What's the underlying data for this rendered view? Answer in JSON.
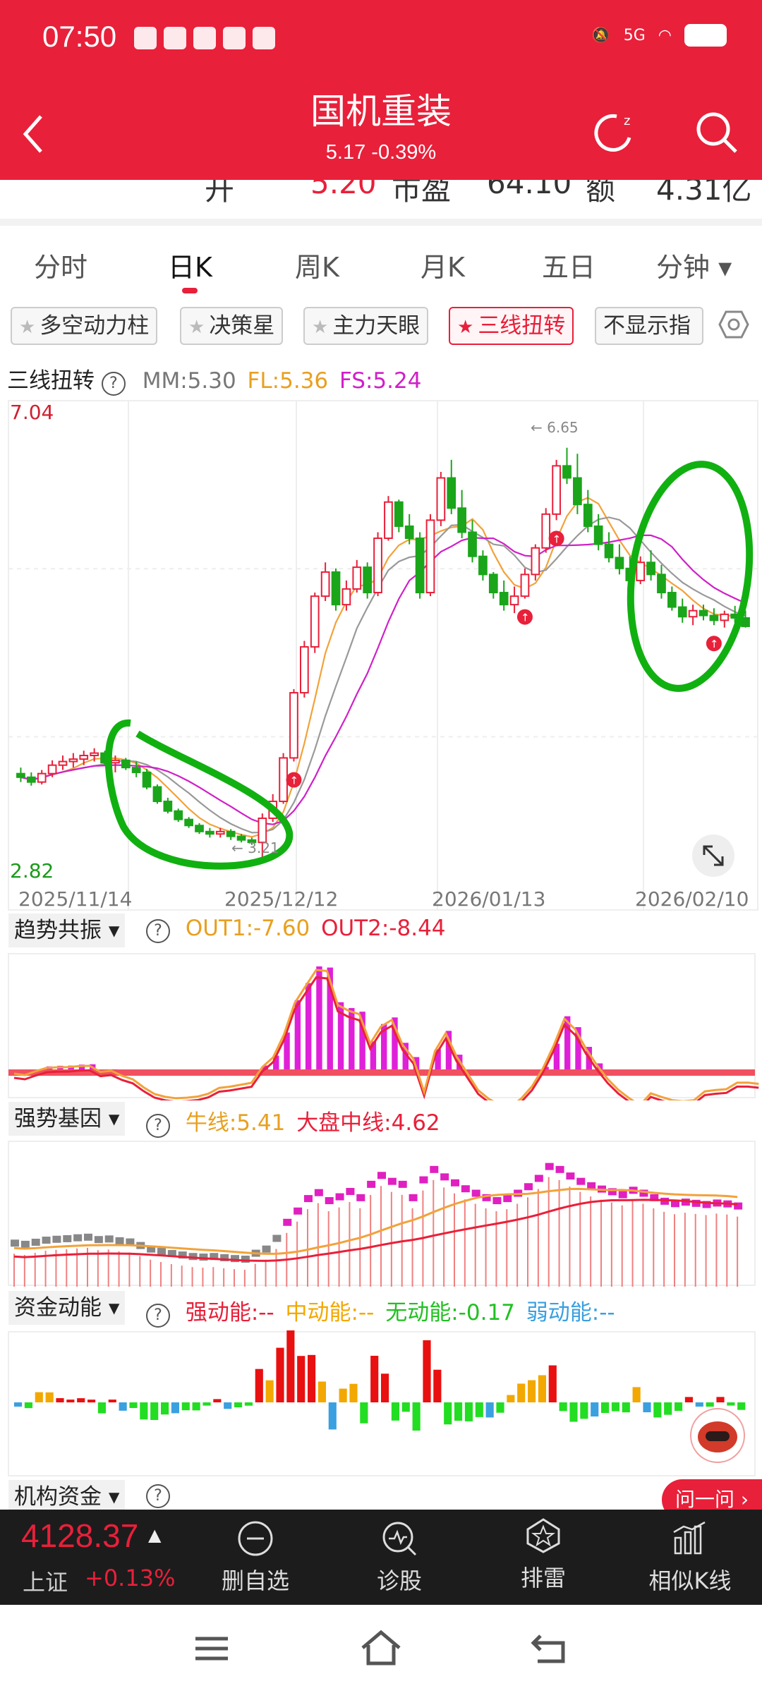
{
  "status": {
    "time": "07:50",
    "network": "5G"
  },
  "header": {
    "title": "国机重装",
    "subtitle": "5.17 -0.39%",
    "back_icon": "chevron-left-icon",
    "refresh_icon": "refresh-icon",
    "search_icon": "search-icon"
  },
  "strip": {
    "item1": "开",
    "item2": "5.20",
    "item3": "市盈",
    "item4": "64.10",
    "item5": "额",
    "item6": "4.31亿"
  },
  "tabs": [
    {
      "label": "分时"
    },
    {
      "label": "日K"
    },
    {
      "label": "周K"
    },
    {
      "label": "月K"
    },
    {
      "label": "五日"
    },
    {
      "label": "分钟 ▾"
    }
  ],
  "chips": [
    {
      "label": "多空动力柱"
    },
    {
      "label": "决策星"
    },
    {
      "label": "主力天眼"
    },
    {
      "label": "三线扭转"
    },
    {
      "label": "不显示指"
    }
  ],
  "main_chart": {
    "indicator": "三线扭转",
    "mm": "MM:5.30",
    "fl": "FL:5.36",
    "fs": "FS:5.24",
    "y_max": "7.04",
    "y_min": "2.82",
    "high_label": "← 6.65",
    "low_label": "← 3.21",
    "dates": [
      "2025/11/14",
      "2025/12/12",
      "2026/01/13",
      "2026/02/10"
    ],
    "colors": {
      "up": "#e8203a",
      "down": "#1aa51a",
      "mm": "#999999",
      "fl": "#f2a23a",
      "fs": "#d020c8"
    }
  },
  "chart_data": {
    "type": "candlestick",
    "ylim": [
      2.82,
      7.04
    ],
    "ohlc": [
      [
        3.95,
        4.0,
        3.88,
        3.92
      ],
      [
        3.92,
        3.96,
        3.85,
        3.88
      ],
      [
        3.88,
        3.98,
        3.86,
        3.95
      ],
      [
        3.95,
        4.06,
        3.92,
        4.02
      ],
      [
        4.02,
        4.1,
        3.98,
        4.05
      ],
      [
        4.05,
        4.12,
        4.0,
        4.07
      ],
      [
        4.07,
        4.14,
        4.02,
        4.1
      ],
      [
        4.1,
        4.16,
        4.05,
        4.12
      ],
      [
        4.12,
        4.14,
        4.02,
        4.04
      ],
      [
        4.04,
        4.1,
        3.96,
        4.06
      ],
      [
        4.06,
        4.08,
        3.98,
        4.0
      ],
      [
        4.0,
        4.05,
        3.92,
        3.96
      ],
      [
        3.96,
        3.99,
        3.82,
        3.84
      ],
      [
        3.84,
        3.86,
        3.7,
        3.72
      ],
      [
        3.72,
        3.75,
        3.62,
        3.64
      ],
      [
        3.64,
        3.66,
        3.55,
        3.57
      ],
      [
        3.57,
        3.59,
        3.5,
        3.52
      ],
      [
        3.52,
        3.54,
        3.45,
        3.47
      ],
      [
        3.47,
        3.5,
        3.42,
        3.45
      ],
      [
        3.45,
        3.5,
        3.42,
        3.47
      ],
      [
        3.47,
        3.49,
        3.4,
        3.43
      ],
      [
        3.43,
        3.45,
        3.38,
        3.4
      ],
      [
        3.4,
        3.42,
        3.36,
        3.38
      ],
      [
        3.38,
        3.62,
        3.21,
        3.58
      ],
      [
        3.58,
        3.78,
        3.55,
        3.72
      ],
      [
        3.72,
        4.12,
        3.7,
        4.08
      ],
      [
        4.08,
        4.65,
        4.05,
        4.62
      ],
      [
        4.62,
        5.05,
        4.58,
        5.0
      ],
      [
        5.0,
        5.45,
        4.95,
        5.42
      ],
      [
        5.42,
        5.7,
        5.38,
        5.62
      ],
      [
        5.62,
        5.65,
        5.3,
        5.35
      ],
      [
        5.35,
        5.55,
        5.3,
        5.48
      ],
      [
        5.48,
        5.72,
        5.45,
        5.66
      ],
      [
        5.66,
        5.7,
        5.4,
        5.45
      ],
      [
        5.45,
        5.95,
        5.42,
        5.9
      ],
      [
        5.9,
        6.25,
        5.88,
        6.2
      ],
      [
        6.2,
        6.22,
        5.95,
        6.0
      ],
      [
        6.0,
        6.1,
        5.85,
        5.9
      ],
      [
        5.9,
        5.95,
        5.4,
        5.45
      ],
      [
        5.45,
        6.1,
        5.42,
        6.05
      ],
      [
        6.05,
        6.45,
        6.0,
        6.4
      ],
      [
        6.4,
        6.55,
        6.1,
        6.15
      ],
      [
        6.15,
        6.3,
        5.9,
        5.95
      ],
      [
        5.95,
        6.05,
        5.7,
        5.75
      ],
      [
        5.75,
        5.8,
        5.55,
        5.6
      ],
      [
        5.6,
        5.62,
        5.4,
        5.45
      ],
      [
        5.45,
        5.55,
        5.3,
        5.35
      ],
      [
        5.35,
        5.5,
        5.28,
        5.42
      ],
      [
        5.42,
        5.65,
        5.4,
        5.6
      ],
      [
        5.6,
        5.85,
        5.55,
        5.82
      ],
      [
        5.82,
        6.15,
        5.78,
        6.1
      ],
      [
        6.1,
        6.55,
        6.05,
        6.5
      ],
      [
        6.5,
        6.65,
        6.35,
        6.4
      ],
      [
        6.4,
        6.6,
        6.1,
        6.18
      ],
      [
        6.18,
        6.3,
        5.95,
        6.0
      ],
      [
        6.0,
        6.1,
        5.8,
        5.85
      ],
      [
        5.85,
        5.95,
        5.7,
        5.74
      ],
      [
        5.74,
        5.85,
        5.6,
        5.65
      ],
      [
        5.65,
        5.75,
        5.5,
        5.55
      ],
      [
        5.55,
        5.75,
        5.52,
        5.7
      ],
      [
        5.7,
        5.8,
        5.55,
        5.6
      ],
      [
        5.6,
        5.68,
        5.4,
        5.45
      ],
      [
        5.45,
        5.5,
        5.3,
        5.33
      ],
      [
        5.33,
        5.4,
        5.2,
        5.25
      ],
      [
        5.25,
        5.35,
        5.18,
        5.3
      ],
      [
        5.3,
        5.35,
        5.22,
        5.26
      ],
      [
        5.26,
        5.32,
        5.18,
        5.22
      ],
      [
        5.22,
        5.3,
        5.16,
        5.27
      ],
      [
        5.27,
        5.34,
        5.2,
        5.24
      ],
      [
        5.24,
        5.3,
        5.16,
        5.17
      ]
    ]
  },
  "trend": {
    "name": "趋势共振",
    "out1": "OUT1:-7.60",
    "out2": "OUT2:-8.44"
  },
  "strong": {
    "name": "强势基因",
    "bull": "牛线:5.41",
    "market": "大盘中线:4.62"
  },
  "funds": {
    "name": "资金动能",
    "strong": "强动能:--",
    "mid": "中动能:--",
    "none": "无动能:-0.17",
    "weak": "弱动能:--"
  },
  "inst": {
    "name": "机构资金"
  },
  "ask": {
    "label": "问一问 ›"
  },
  "bottom": {
    "index_value": "4128.37",
    "index_name": "上证",
    "index_change": "+0.13%",
    "items": [
      {
        "label": "删自选",
        "icon": "minus-circle-icon"
      },
      {
        "label": "诊股",
        "icon": "diagnose-icon"
      },
      {
        "label": "排雷",
        "icon": "mine-icon"
      },
      {
        "label": "相似K线",
        "icon": "similar-kline-icon"
      }
    ]
  }
}
